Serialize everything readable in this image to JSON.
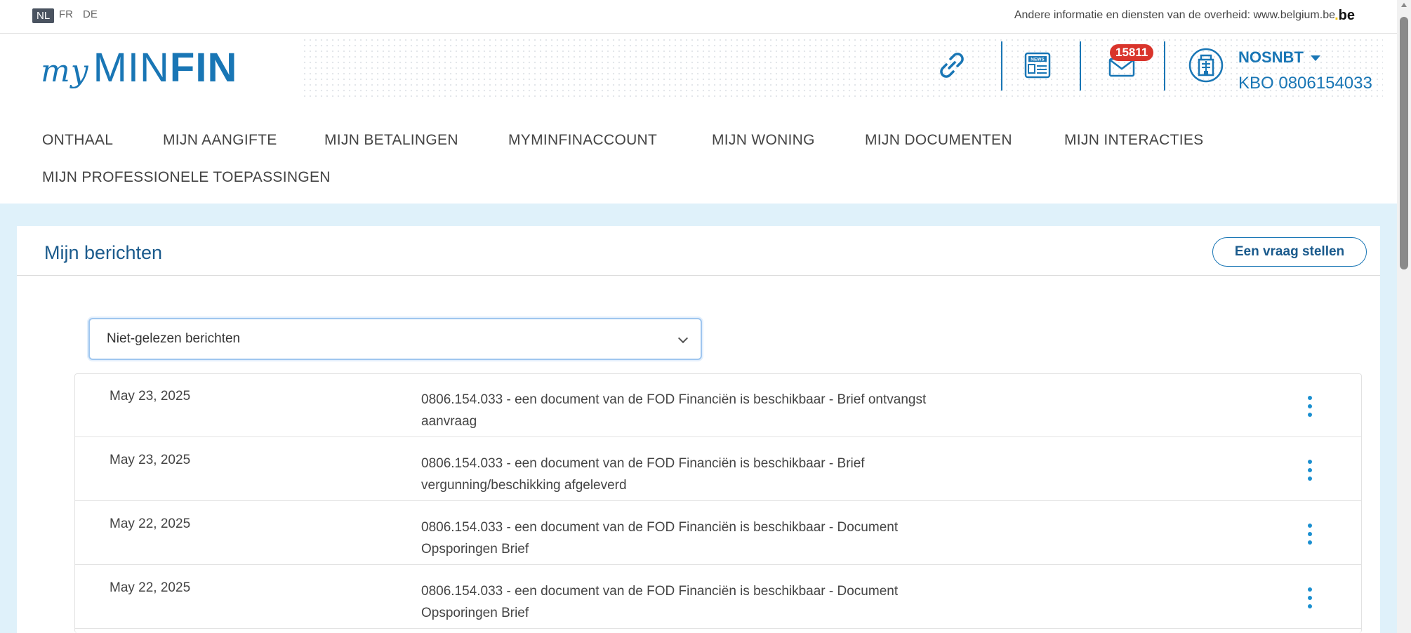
{
  "languages": [
    {
      "code": "NL",
      "active": true
    },
    {
      "code": "FR",
      "active": false
    },
    {
      "code": "DE",
      "active": false
    }
  ],
  "gov_text": "Andere informatie en diensten van de overheid: www.belgium.be",
  "be_logo": "be",
  "logo": {
    "my": "my",
    "min": "MIN",
    "fin": "FIN"
  },
  "header": {
    "mail_badge": "15811",
    "user_name": "NOSNBT",
    "user_kbo": "KBO 0806154033",
    "icons": [
      "link-icon",
      "news-icon",
      "mail-icon",
      "building-icon"
    ]
  },
  "nav": [
    "ONTHAAL",
    "MIJN AANGIFTE",
    "MIJN BETALINGEN",
    "MYMINFINACCOUNT",
    "MIJN WONING",
    "MIJN DOCUMENTEN",
    "MIJN INTERACTIES",
    "MIJN PROFESSIONELE TOEPASSINGEN"
  ],
  "main": {
    "title": "Mijn berichten",
    "ask_button": "Een vraag stellen",
    "filter_value": "Niet-gelezen berichten",
    "messages": [
      {
        "date": "May 23, 2025",
        "subject": "0806.154.033 - een document van de FOD Financiën is beschikbaar - Brief ontvangst aanvraag"
      },
      {
        "date": "May 23, 2025",
        "subject": "0806.154.033 - een document van de FOD Financiën is beschikbaar - Brief vergunning/beschikking afgeleverd"
      },
      {
        "date": "May 22, 2025",
        "subject": "0806.154.033 - een document van de FOD Financiën is beschikbaar - Document Opsporingen Brief"
      },
      {
        "date": "May 22, 2025",
        "subject": "0806.154.033 - een document van de FOD Financiën is beschikbaar - Document Opsporingen Brief"
      }
    ]
  },
  "colors": {
    "brand_blue": "#1976b5",
    "badge_red": "#d9342b",
    "band_bg": "#dff1fa"
  }
}
